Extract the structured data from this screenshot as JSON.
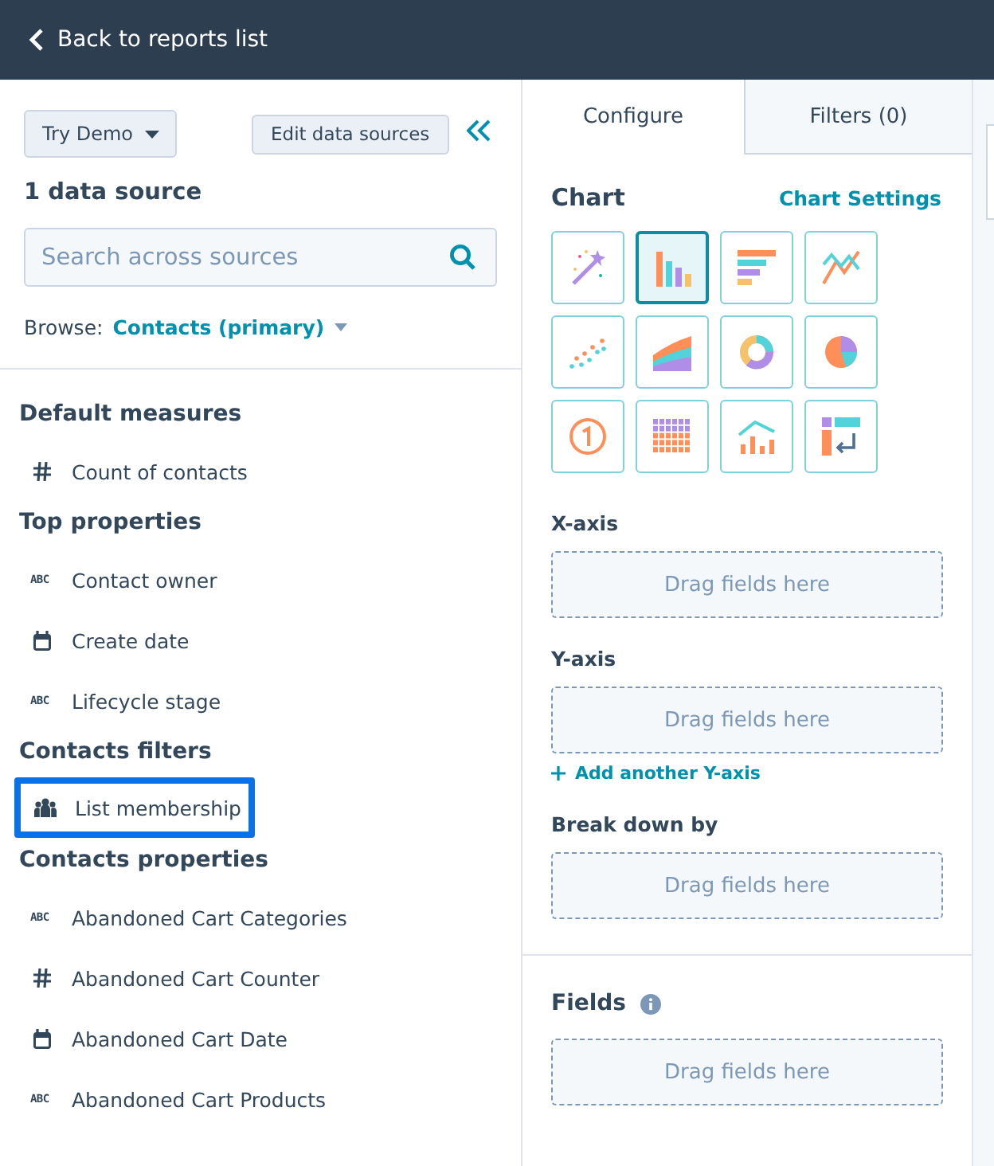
{
  "header": {
    "back_link": "Back to reports list"
  },
  "left_panel": {
    "demo_button": "Try Demo",
    "edit_button": "Edit data sources",
    "source_count": "1 data source",
    "search": {
      "placeholder": "Search across sources"
    },
    "browse_label": "Browse:",
    "browse_value": "Contacts (primary)",
    "sections": [
      {
        "title": "Default measures",
        "items": [
          {
            "kind": "number",
            "label": "Count of contacts",
            "highlighted": false
          }
        ]
      },
      {
        "title": "Top properties",
        "items": [
          {
            "kind": "text",
            "badge": "ABC",
            "label": "Contact owner",
            "highlighted": false
          },
          {
            "kind": "date",
            "label": "Create date",
            "highlighted": false
          },
          {
            "kind": "text",
            "badge": "ABC",
            "label": "Lifecycle stage",
            "highlighted": false
          }
        ]
      },
      {
        "title": "Contacts filters",
        "items": [
          {
            "kind": "list",
            "label": "List membership",
            "highlighted": true
          }
        ]
      },
      {
        "title": "Contacts properties",
        "items": [
          {
            "kind": "text",
            "badge": "ABC",
            "label": "Abandoned Cart Categories",
            "highlighted": false
          },
          {
            "kind": "number",
            "label": "Abandoned Cart Counter",
            "highlighted": false
          },
          {
            "kind": "date",
            "label": "Abandoned Cart Date",
            "highlighted": false
          },
          {
            "kind": "text",
            "badge": "ABC",
            "label": "Abandoned Cart Products",
            "highlighted": false
          }
        ]
      }
    ]
  },
  "tabs": [
    {
      "label": "Configure",
      "selected": true
    },
    {
      "label": "Filters (0)",
      "selected": false
    }
  ],
  "chart": {
    "title": "Chart",
    "settings_link": "Chart Settings",
    "types": [
      {
        "kind": "magic",
        "selected": false
      },
      {
        "kind": "column",
        "selected": true
      },
      {
        "kind": "bar",
        "selected": false
      },
      {
        "kind": "line",
        "selected": false
      },
      {
        "kind": "scatter",
        "selected": false
      },
      {
        "kind": "area",
        "selected": false
      },
      {
        "kind": "donut",
        "selected": false
      },
      {
        "kind": "pie",
        "selected": false
      },
      {
        "kind": "single",
        "selected": false
      },
      {
        "kind": "grid",
        "selected": false
      },
      {
        "kind": "combo",
        "selected": false
      },
      {
        "kind": "pivot",
        "selected": false
      }
    ]
  },
  "drop_zones": [
    {
      "label": "X-axis",
      "placeholder": "Drag fields here"
    },
    {
      "label": "Y-axis",
      "placeholder": "Drag fields here",
      "add_link": "Add another Y-axis"
    },
    {
      "label": "Break down by",
      "placeholder": "Drag fields here"
    }
  ],
  "fields": {
    "title": "Fields",
    "placeholder": "Drag fields here"
  }
}
